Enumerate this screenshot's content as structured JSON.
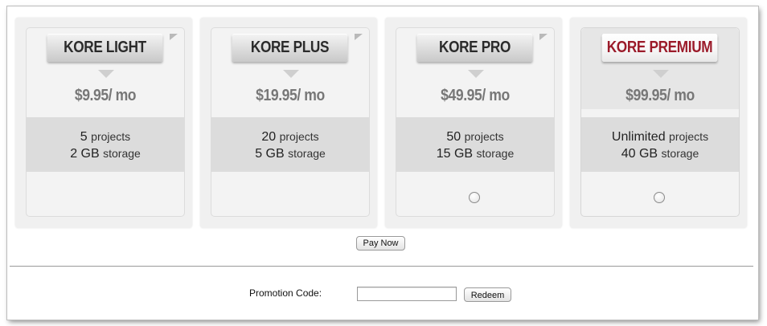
{
  "plans": [
    {
      "name": "KORE LIGHT",
      "price": "$9.95/ mo",
      "projects_count": "5",
      "projects_unit": "projects",
      "storage_amount": "2 GB",
      "storage_unit": "storage",
      "radio_visible": false
    },
    {
      "name": "KORE PLUS",
      "price": "$19.95/ mo",
      "projects_count": "20",
      "projects_unit": "projects",
      "storage_amount": "5 GB",
      "storage_unit": "storage",
      "radio_visible": false
    },
    {
      "name": "KORE PRO",
      "price": "$49.95/ mo",
      "projects_count": "50",
      "projects_unit": "projects",
      "storage_amount": "15 GB",
      "storage_unit": "storage",
      "radio_visible": true
    },
    {
      "name": "KORE PREMIUM",
      "price": "$99.95/ mo",
      "projects_count": "Unlimited",
      "projects_unit": "projects",
      "storage_amount": "40 GB",
      "storage_unit": "storage",
      "radio_visible": true
    }
  ],
  "actions": {
    "pay_label": "Pay Now"
  },
  "promotion": {
    "label": "Promotion Code:",
    "value": "",
    "redeem_label": "Redeem"
  },
  "colors": {
    "premium_title": "#9b1b2a",
    "card_bg": "#f0f0f0",
    "feature_band": "#dcdcdc"
  }
}
